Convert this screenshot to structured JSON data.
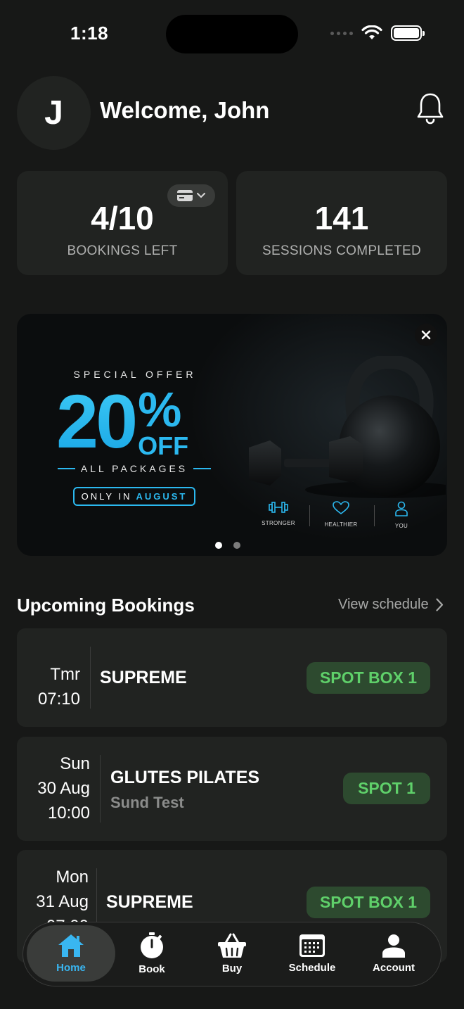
{
  "status_bar": {
    "time": "1:18"
  },
  "header": {
    "avatar_initial": "J",
    "welcome": "Welcome, John"
  },
  "stats": {
    "bookings_value": "4/10",
    "bookings_label": "BOOKINGS LEFT",
    "sessions_value": "141",
    "sessions_label": "SESSIONS COMPLETED"
  },
  "promo": {
    "eyebrow": "SPECIAL OFFER",
    "number": "20",
    "percent": "%",
    "off": "OFF",
    "scope": "ALL PACKAGES",
    "only_in": "ONLY IN",
    "month": "AUGUST",
    "features": [
      "STRONGER",
      "HEALTHIER",
      "YOU"
    ],
    "slide_count": 2,
    "active_slide": 1
  },
  "upcoming": {
    "title": "Upcoming Bookings",
    "view_link": "View schedule",
    "bookings": [
      {
        "day": "Tmr",
        "date": "",
        "time": "07:10",
        "class": "SUPREME",
        "subtitle": "",
        "spot": "SPOT BOX 1"
      },
      {
        "day": "Sun",
        "date": "30 Aug",
        "time": "10:00",
        "class": "GLUTES PILATES",
        "subtitle": "Sund Test",
        "spot": "SPOT 1"
      },
      {
        "day": "Mon",
        "date": "31 Aug",
        "time": "07:00",
        "class": "SUPREME",
        "subtitle": "",
        "spot": "SPOT BOX 1"
      }
    ]
  },
  "tabbar": {
    "active": "Home",
    "items": [
      "Home",
      "Book",
      "Buy",
      "Schedule",
      "Account"
    ]
  },
  "colors": {
    "accent": "#39b6f1",
    "badge_bg": "#2d4a2f",
    "badge_text": "#5fd06a",
    "card_bg": "#212321",
    "background": "#171817"
  }
}
